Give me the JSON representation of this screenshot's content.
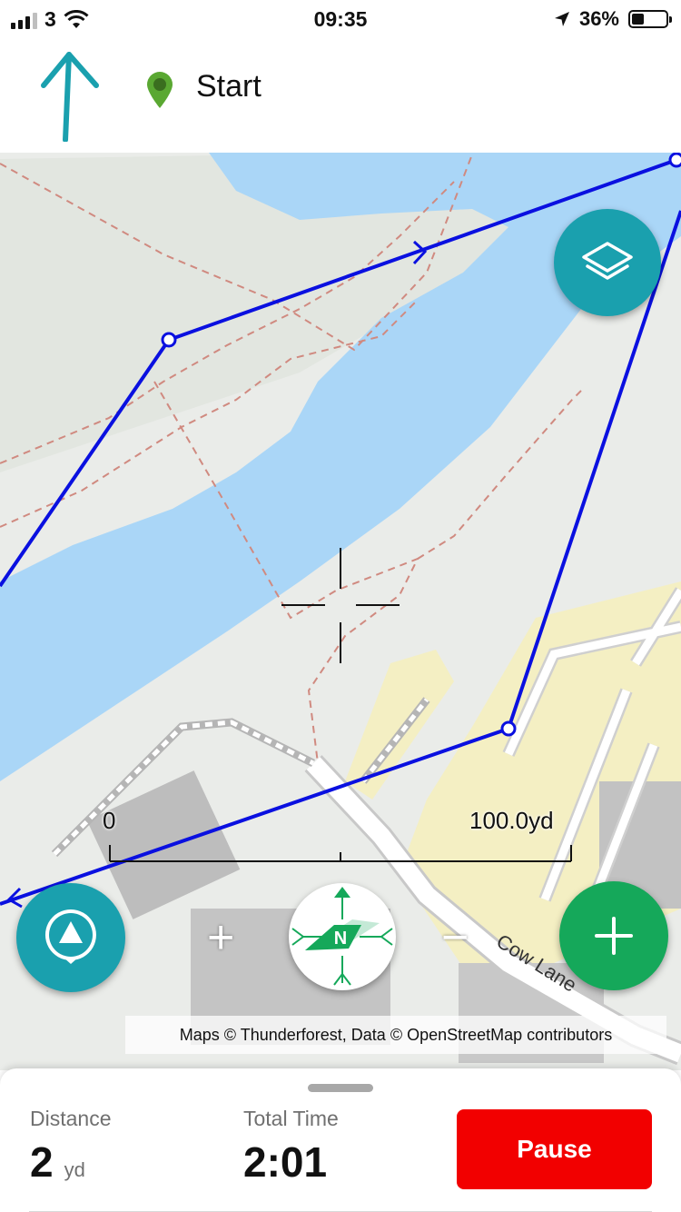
{
  "status_bar": {
    "carrier": "3",
    "time": "09:35",
    "battery_percent": "36%",
    "battery_level": 0.36,
    "icons": [
      "signal-icon",
      "wifi-icon",
      "location-arrow-icon",
      "battery-icon"
    ]
  },
  "header": {
    "title": "Start",
    "direction_icon": "up-arrow-icon",
    "pin_icon": "map-pin-icon",
    "pin_color": "#5aa832",
    "arrow_color": "#1aa0ae"
  },
  "map": {
    "scale": {
      "start_label": "0",
      "end_label": "100.0yd"
    },
    "street_label": "Cow Lane",
    "attribution": "Maps © Thunderforest, Data © OpenStreetMap contributors",
    "zoom_in_label": "+",
    "zoom_out_label": "−",
    "compass_label": "N",
    "route_color": "#0a10e0",
    "buttons": {
      "layers": "layers-icon",
      "locate": "locate-icon",
      "add": "plus-icon"
    }
  },
  "stats": {
    "distance_label": "Distance",
    "distance_value": "2",
    "distance_unit": "yd",
    "time_label": "Total Time",
    "time_value": "2:01",
    "pause_label": "Pause"
  },
  "colors": {
    "teal": "#1aa0ae",
    "green": "#15a85a",
    "pause_red": "#f20000",
    "water": "#aad6f7",
    "land": "#eaece9",
    "residential": "#f4efc3"
  }
}
